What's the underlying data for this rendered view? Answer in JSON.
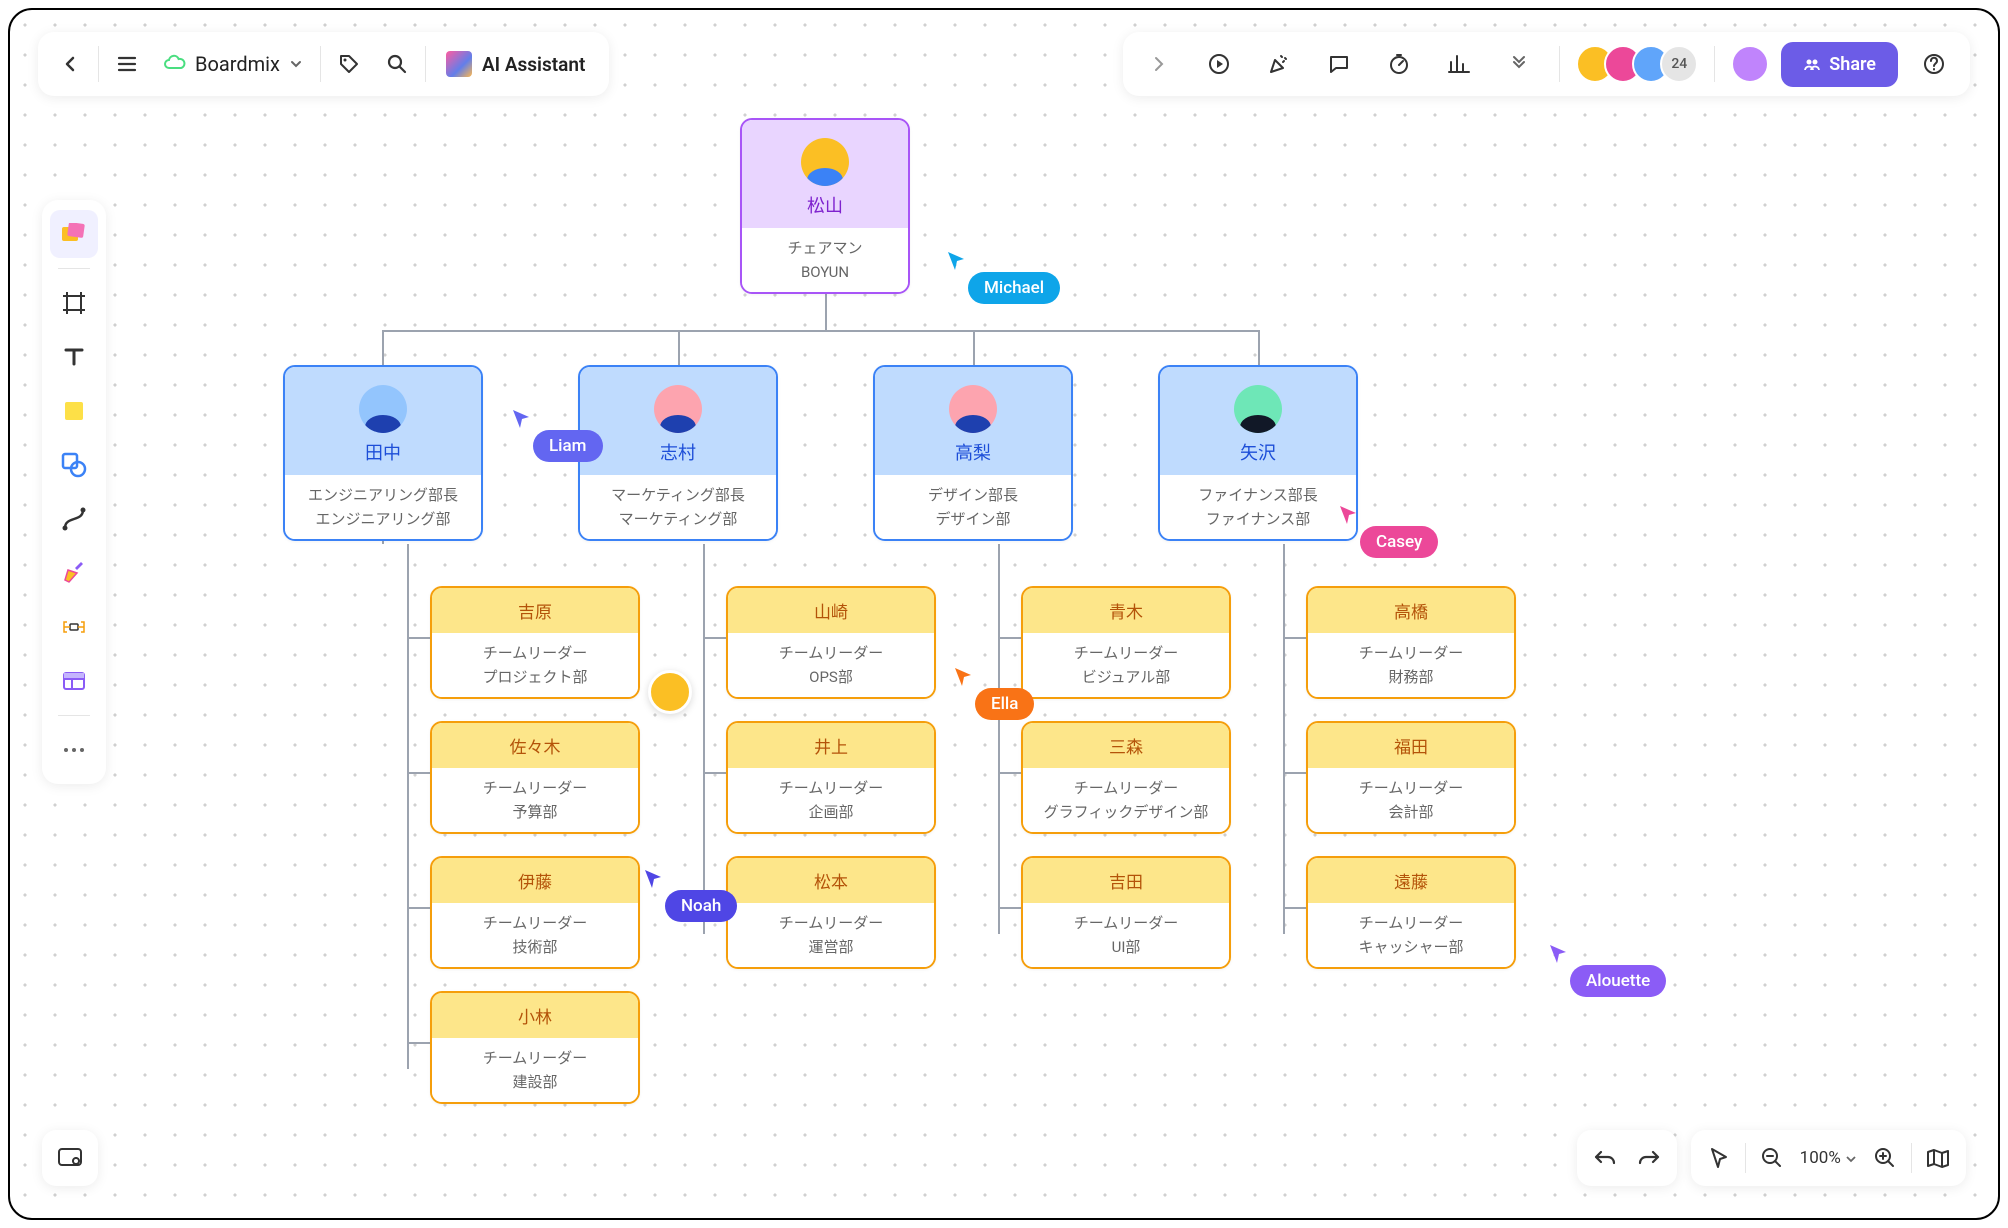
{
  "header": {
    "board_name": "Boardmix",
    "ai_label": "AI Assistant",
    "avatar_overflow": "24",
    "share_label": "Share"
  },
  "zoom": {
    "value": "100%"
  },
  "org": {
    "root": {
      "name": "松山",
      "title": "チェアマン",
      "dept": "BOYUN"
    },
    "depts": [
      {
        "name": "田中",
        "title": "エンジニアリング部長",
        "dept": "エンジニアリング部"
      },
      {
        "name": "志村",
        "title": "マーケティング部長",
        "dept": "マーケティング部"
      },
      {
        "name": "高梨",
        "title": "デザイン部長",
        "dept": "デザイン部"
      },
      {
        "name": "矢沢",
        "title": "ファイナンス部長",
        "dept": "ファイナンス部"
      }
    ],
    "teams": {
      "col0": [
        {
          "name": "吉原",
          "title": "チームリーダー",
          "dept": "プロジェクト部"
        },
        {
          "name": "佐々木",
          "title": "チームリーダー",
          "dept": "予算部"
        },
        {
          "name": "伊藤",
          "title": "チームリーダー",
          "dept": "技術部"
        },
        {
          "name": "小林",
          "title": "チームリーダー",
          "dept": "建設部"
        }
      ],
      "col1": [
        {
          "name": "山崎",
          "title": "チームリーダー",
          "dept": "OPS部"
        },
        {
          "name": "井上",
          "title": "チームリーダー",
          "dept": "企画部"
        },
        {
          "name": "松本",
          "title": "チームリーダー",
          "dept": "運営部"
        }
      ],
      "col2": [
        {
          "name": "青木",
          "title": "チームリーダー",
          "dept": "ビジュアル部"
        },
        {
          "name": "三森",
          "title": "チームリーダー",
          "dept": "グラフィックデザイン部"
        },
        {
          "name": "吉田",
          "title": "チームリーダー",
          "dept": "UI部"
        }
      ],
      "col3": [
        {
          "name": "高橋",
          "title": "チームリーダー",
          "dept": "財務部"
        },
        {
          "name": "福田",
          "title": "チームリーダー",
          "dept": "会計部"
        },
        {
          "name": "遠藤",
          "title": "チームリーダー",
          "dept": "キャッシャー部"
        }
      ]
    }
  },
  "cursors": {
    "michael": "Michael",
    "liam": "Liam",
    "ella": "Ella",
    "noah": "Noah",
    "casey": "Casey",
    "alouette": "Alouette"
  },
  "colors": {
    "michael": "#0ea5e9",
    "liam": "#6366f1",
    "ella": "#f97316",
    "noah": "#4f46e5",
    "casey": "#ec4899",
    "alouette": "#8b5cf6"
  }
}
